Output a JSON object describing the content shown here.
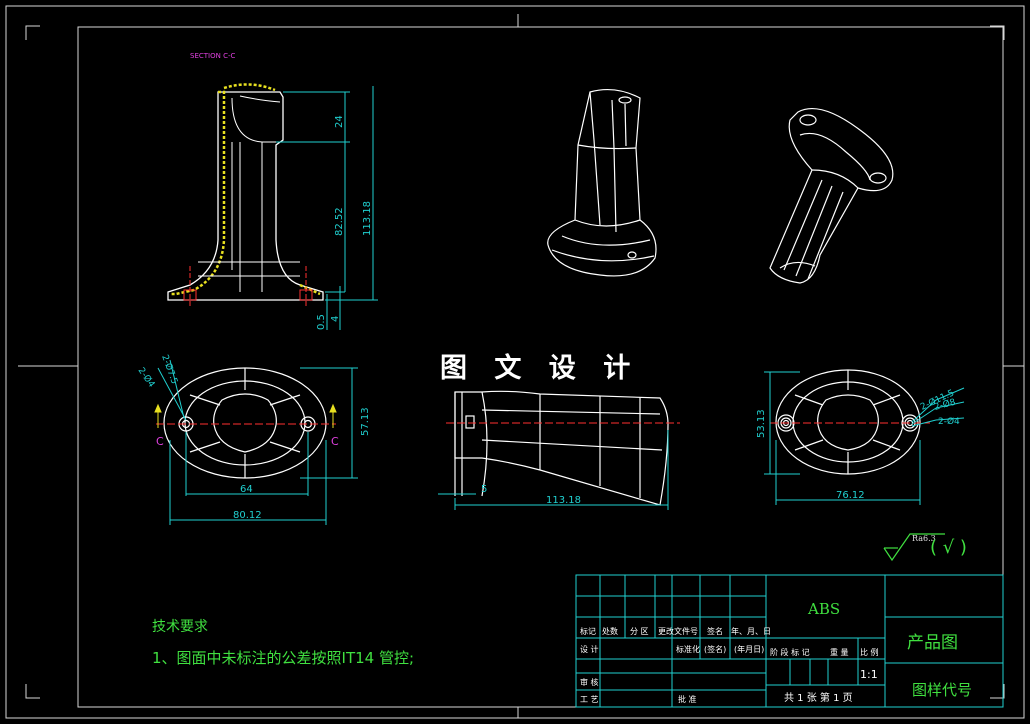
{
  "section_label": "SECTION C-C",
  "watermark": "图 文 设 计",
  "dims_front": {
    "d1": "24",
    "d2": "82.52",
    "d3": "113.18",
    "d4": "0.5",
    "d5": "4"
  },
  "dims_top": {
    "d1": "2-Ø4",
    "d2": "2-Ø7.5",
    "d3": "64",
    "d4": "80.12",
    "d5": "57.13",
    "sec_a": "C",
    "sec_b": "C"
  },
  "dims_side": {
    "d1": "5",
    "d2": "113.18"
  },
  "dims_bottom": {
    "d1": "53.13",
    "d2": "76.12",
    "d3": "2-Ø11.5",
    "d4": "2-Ø8",
    "d5": "2-Ø4"
  },
  "roughness": {
    "value": "Ra6.3",
    "paren": "( √ )"
  },
  "tech": {
    "title": "技术要求",
    "line1": "1、图面中未标注的公差按照IT14 管控;"
  },
  "title_block": {
    "material": "ABS",
    "name": "产品图",
    "code": "图样代号",
    "scale": "1:1",
    "rev_headers": [
      "标记",
      "处数",
      "分 区",
      "更改文件号",
      "签名",
      "年、月、日"
    ],
    "row_design": "设 计",
    "row_std": "标准化",
    "row_sign": "(签名)",
    "row_date": "(年月日)",
    "row_review": "审 核",
    "row_craft": "工 艺",
    "row_approve": "批 准",
    "stage_headers": [
      "阶 段 标 记",
      "重 量",
      "比 例"
    ],
    "sheets": "共 1 张   第 1 页"
  }
}
